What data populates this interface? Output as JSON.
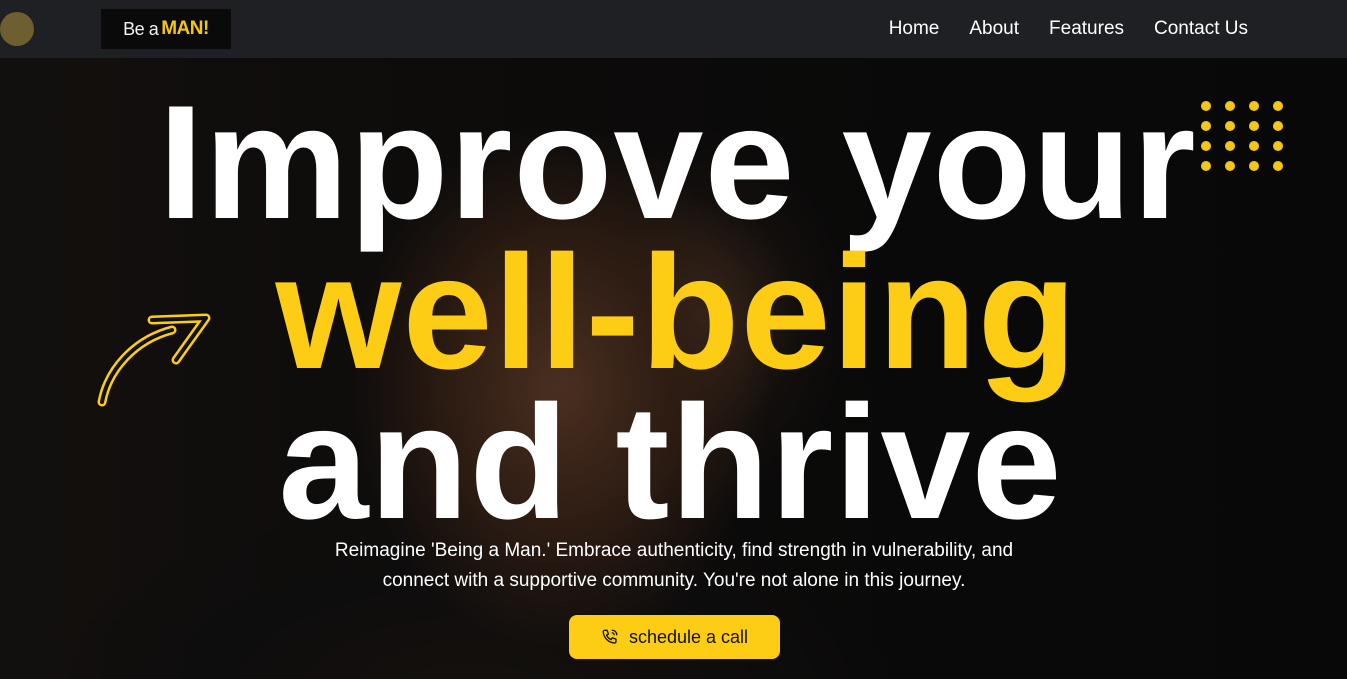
{
  "navbar": {
    "logo": {
      "prefix": "Be a",
      "brand": "MAN!"
    },
    "links": [
      {
        "label": "Home"
      },
      {
        "label": "About"
      },
      {
        "label": "Features"
      },
      {
        "label": "Contact Us"
      }
    ]
  },
  "hero": {
    "headline": {
      "line1": "Improve your",
      "line2": "well-being",
      "line3": "and thrive"
    },
    "subtext_line1": "Reimagine 'Being a Man.' Embrace authenticity, find strength in vulnerability, and",
    "subtext_line2": "connect with a supportive community. You're not alone in this journey.",
    "cta_label": "schedule a call",
    "cta_icon": "phone-icon",
    "decor_icons": [
      "dot-grid-icon",
      "curved-arrow-icon"
    ]
  },
  "colors": {
    "accent": "#fccd14",
    "navbar_bg": "#1f2023",
    "text": "#ffffff"
  }
}
